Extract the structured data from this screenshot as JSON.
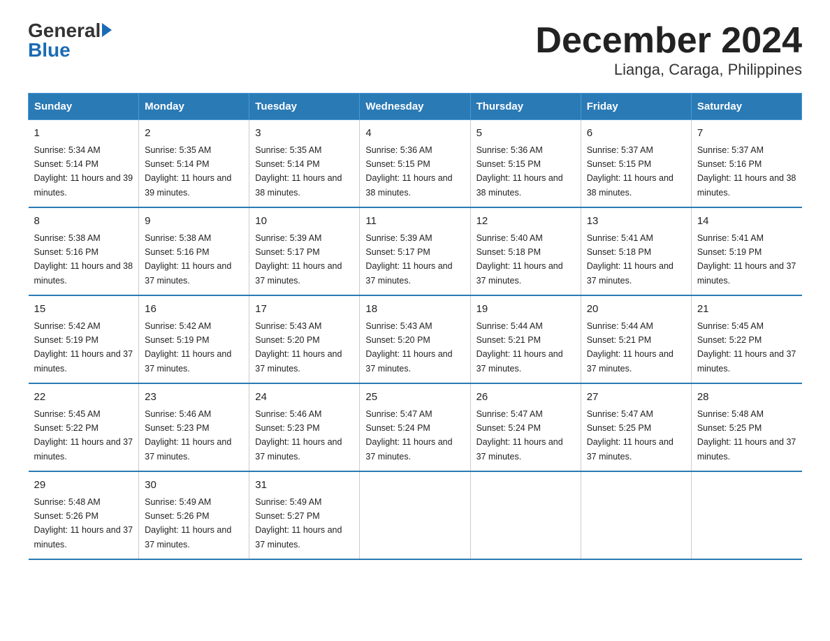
{
  "header": {
    "logo_general": "General",
    "logo_blue": "Blue",
    "title": "December 2024",
    "subtitle": "Lianga, Caraga, Philippines"
  },
  "days_of_week": [
    "Sunday",
    "Monday",
    "Tuesday",
    "Wednesday",
    "Thursday",
    "Friday",
    "Saturday"
  ],
  "weeks": [
    [
      {
        "day": "1",
        "sunrise": "5:34 AM",
        "sunset": "5:14 PM",
        "daylight": "11 hours and 39 minutes."
      },
      {
        "day": "2",
        "sunrise": "5:35 AM",
        "sunset": "5:14 PM",
        "daylight": "11 hours and 39 minutes."
      },
      {
        "day": "3",
        "sunrise": "5:35 AM",
        "sunset": "5:14 PM",
        "daylight": "11 hours and 38 minutes."
      },
      {
        "day": "4",
        "sunrise": "5:36 AM",
        "sunset": "5:15 PM",
        "daylight": "11 hours and 38 minutes."
      },
      {
        "day": "5",
        "sunrise": "5:36 AM",
        "sunset": "5:15 PM",
        "daylight": "11 hours and 38 minutes."
      },
      {
        "day": "6",
        "sunrise": "5:37 AM",
        "sunset": "5:15 PM",
        "daylight": "11 hours and 38 minutes."
      },
      {
        "day": "7",
        "sunrise": "5:37 AM",
        "sunset": "5:16 PM",
        "daylight": "11 hours and 38 minutes."
      }
    ],
    [
      {
        "day": "8",
        "sunrise": "5:38 AM",
        "sunset": "5:16 PM",
        "daylight": "11 hours and 38 minutes."
      },
      {
        "day": "9",
        "sunrise": "5:38 AM",
        "sunset": "5:16 PM",
        "daylight": "11 hours and 37 minutes."
      },
      {
        "day": "10",
        "sunrise": "5:39 AM",
        "sunset": "5:17 PM",
        "daylight": "11 hours and 37 minutes."
      },
      {
        "day": "11",
        "sunrise": "5:39 AM",
        "sunset": "5:17 PM",
        "daylight": "11 hours and 37 minutes."
      },
      {
        "day": "12",
        "sunrise": "5:40 AM",
        "sunset": "5:18 PM",
        "daylight": "11 hours and 37 minutes."
      },
      {
        "day": "13",
        "sunrise": "5:41 AM",
        "sunset": "5:18 PM",
        "daylight": "11 hours and 37 minutes."
      },
      {
        "day": "14",
        "sunrise": "5:41 AM",
        "sunset": "5:19 PM",
        "daylight": "11 hours and 37 minutes."
      }
    ],
    [
      {
        "day": "15",
        "sunrise": "5:42 AM",
        "sunset": "5:19 PM",
        "daylight": "11 hours and 37 minutes."
      },
      {
        "day": "16",
        "sunrise": "5:42 AM",
        "sunset": "5:19 PM",
        "daylight": "11 hours and 37 minutes."
      },
      {
        "day": "17",
        "sunrise": "5:43 AM",
        "sunset": "5:20 PM",
        "daylight": "11 hours and 37 minutes."
      },
      {
        "day": "18",
        "sunrise": "5:43 AM",
        "sunset": "5:20 PM",
        "daylight": "11 hours and 37 minutes."
      },
      {
        "day": "19",
        "sunrise": "5:44 AM",
        "sunset": "5:21 PM",
        "daylight": "11 hours and 37 minutes."
      },
      {
        "day": "20",
        "sunrise": "5:44 AM",
        "sunset": "5:21 PM",
        "daylight": "11 hours and 37 minutes."
      },
      {
        "day": "21",
        "sunrise": "5:45 AM",
        "sunset": "5:22 PM",
        "daylight": "11 hours and 37 minutes."
      }
    ],
    [
      {
        "day": "22",
        "sunrise": "5:45 AM",
        "sunset": "5:22 PM",
        "daylight": "11 hours and 37 minutes."
      },
      {
        "day": "23",
        "sunrise": "5:46 AM",
        "sunset": "5:23 PM",
        "daylight": "11 hours and 37 minutes."
      },
      {
        "day": "24",
        "sunrise": "5:46 AM",
        "sunset": "5:23 PM",
        "daylight": "11 hours and 37 minutes."
      },
      {
        "day": "25",
        "sunrise": "5:47 AM",
        "sunset": "5:24 PM",
        "daylight": "11 hours and 37 minutes."
      },
      {
        "day": "26",
        "sunrise": "5:47 AM",
        "sunset": "5:24 PM",
        "daylight": "11 hours and 37 minutes."
      },
      {
        "day": "27",
        "sunrise": "5:47 AM",
        "sunset": "5:25 PM",
        "daylight": "11 hours and 37 minutes."
      },
      {
        "day": "28",
        "sunrise": "5:48 AM",
        "sunset": "5:25 PM",
        "daylight": "11 hours and 37 minutes."
      }
    ],
    [
      {
        "day": "29",
        "sunrise": "5:48 AM",
        "sunset": "5:26 PM",
        "daylight": "11 hours and 37 minutes."
      },
      {
        "day": "30",
        "sunrise": "5:49 AM",
        "sunset": "5:26 PM",
        "daylight": "11 hours and 37 minutes."
      },
      {
        "day": "31",
        "sunrise": "5:49 AM",
        "sunset": "5:27 PM",
        "daylight": "11 hours and 37 minutes."
      },
      {
        "day": "",
        "sunrise": "",
        "sunset": "",
        "daylight": ""
      },
      {
        "day": "",
        "sunrise": "",
        "sunset": "",
        "daylight": ""
      },
      {
        "day": "",
        "sunrise": "",
        "sunset": "",
        "daylight": ""
      },
      {
        "day": "",
        "sunrise": "",
        "sunset": "",
        "daylight": ""
      }
    ]
  ]
}
